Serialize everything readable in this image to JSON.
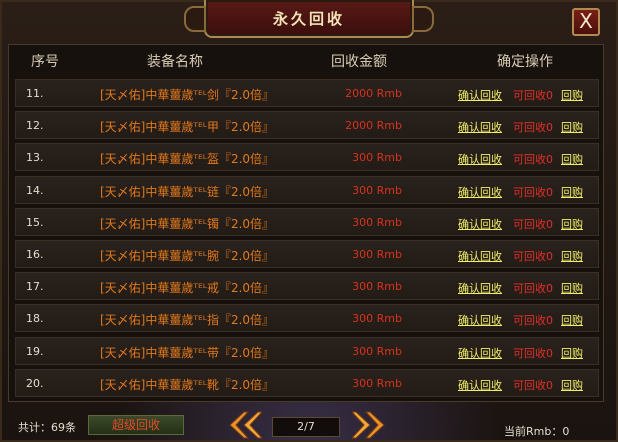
{
  "window": {
    "title": "永久回收",
    "close_label": "X"
  },
  "table": {
    "headers": [
      "序号",
      "装备名称",
      "回收金额",
      "确定操作"
    ],
    "rows": [
      {
        "idx": "11.",
        "name": "[天〆佑]中華薑歲ᵀᴱᴸ剑『2.0倍』",
        "amount": "2000 Rmb",
        "confirm": "确认回收",
        "count": "可回收0",
        "buyback": "回购"
      },
      {
        "idx": "12.",
        "name": "[天〆佑]中華薑歲ᵀᴱᴸ甲『2.0倍』",
        "amount": "2000 Rmb",
        "confirm": "确认回收",
        "count": "可回收0",
        "buyback": "回购"
      },
      {
        "idx": "13.",
        "name": "[天〆佑]中華薑歲ᵀᴱᴸ盔『2.0倍』",
        "amount": "300 Rmb",
        "confirm": "确认回收",
        "count": "可回收0",
        "buyback": "回购"
      },
      {
        "idx": "14.",
        "name": "[天〆佑]中華薑歲ᵀᴱᴸ链『2.0倍』",
        "amount": "300 Rmb",
        "confirm": "确认回收",
        "count": "可回收0",
        "buyback": "回购"
      },
      {
        "idx": "15.",
        "name": "[天〆佑]中華薑歲ᵀᴱᴸ镯『2.0倍』",
        "amount": "300 Rmb",
        "confirm": "确认回收",
        "count": "可回收0",
        "buyback": "回购"
      },
      {
        "idx": "16.",
        "name": "[天〆佑]中華薑歲ᵀᴱᴸ腕『2.0倍』",
        "amount": "300 Rmb",
        "confirm": "确认回收",
        "count": "可回收0",
        "buyback": "回购"
      },
      {
        "idx": "17.",
        "name": "[天〆佑]中華薑歲ᵀᴱᴸ戒『2.0倍』",
        "amount": "300 Rmb",
        "confirm": "确认回收",
        "count": "可回收0",
        "buyback": "回购"
      },
      {
        "idx": "18.",
        "name": "[天〆佑]中華薑歲ᵀᴱᴸ指『2.0倍』",
        "amount": "300 Rmb",
        "confirm": "确认回收",
        "count": "可回收0",
        "buyback": "回购"
      },
      {
        "idx": "19.",
        "name": "[天〆佑]中華薑歲ᵀᴱᴸ带『2.0倍』",
        "amount": "300 Rmb",
        "confirm": "确认回收",
        "count": "可回收0",
        "buyback": "回购"
      },
      {
        "idx": "20.",
        "name": "[天〆佑]中華薑歲ᵀᴱᴸ靴『2.0倍』",
        "amount": "300 Rmb",
        "confirm": "确认回收",
        "count": "可回收0",
        "buyback": "回购"
      }
    ]
  },
  "footer": {
    "total": "共计：69条",
    "super_button": "超级回收",
    "page": "2/7",
    "balance": "当前Rmb：0"
  },
  "icons": {
    "prev": "chevron-double-left-icon",
    "next": "chevron-double-right-icon"
  },
  "colors": {
    "item_name": "#e0781c",
    "amount": "#d8321e",
    "link": "#f2ef6a",
    "count": "#e0302a"
  }
}
